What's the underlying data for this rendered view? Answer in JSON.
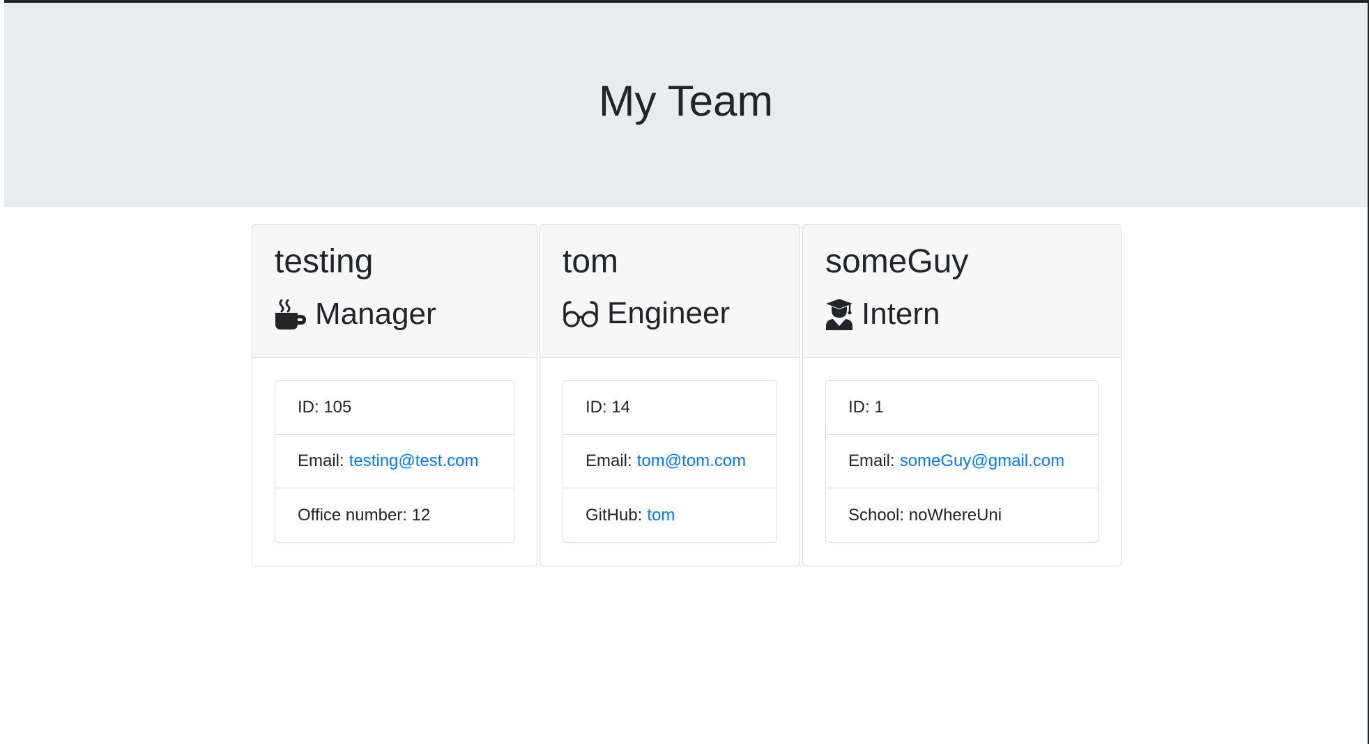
{
  "header": {
    "title": "My Team"
  },
  "employees": [
    {
      "name": "testing",
      "role": "Manager",
      "icon": "coffee-mug-icon",
      "id_label": "ID: 105",
      "email_prefix": "Email:",
      "email": "testing@test.com",
      "extra_label": "Office number: 12"
    },
    {
      "name": "tom",
      "role": "Engineer",
      "icon": "glasses-icon",
      "id_label": "ID: 14",
      "email_prefix": "Email:",
      "email": "tom@tom.com",
      "extra_prefix": "GitHub:",
      "extra_link": "tom"
    },
    {
      "name": "someGuy",
      "role": "Intern",
      "icon": "graduate-icon",
      "id_label": "ID: 1",
      "email_prefix": "Email:",
      "email": "someGuy@gmail.com",
      "extra_label": "School: noWhereUni"
    }
  ],
  "colors": {
    "jumbotron_bg": "#e9ecef",
    "card_header_bg": "#f7f7f7",
    "link": "#007bff",
    "text": "#212529"
  }
}
